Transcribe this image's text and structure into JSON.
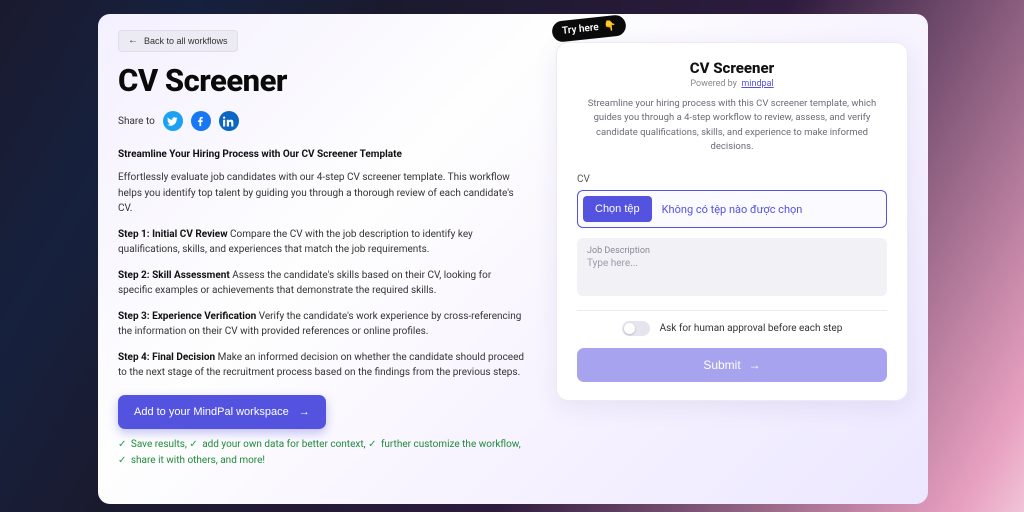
{
  "back_button": "Back to all workflows",
  "title": "CV Screener",
  "share_label": "Share to",
  "subtitle": "Streamline Your Hiring Process with Our CV Screener Template",
  "intro": "Effortlessly evaluate job candidates with our 4-step CV screener template. This workflow helps you identify top talent by guiding you through a thorough review of each candidate's CV.",
  "steps": [
    {
      "lead": "Step 1: Initial CV Review",
      "body": " Compare the CV with the job description to identify key qualifications, skills, and experiences that match the job requirements."
    },
    {
      "lead": "Step 2: Skill Assessment",
      "body": " Assess the candidate's skills based on their CV, looking for specific examples or achievements that demonstrate the required skills."
    },
    {
      "lead": "Step 3: Experience Verification",
      "body": " Verify the candidate's work experience by cross-referencing the information on their CV with provided references or online profiles."
    },
    {
      "lead": "Step 4: Final Decision",
      "body": " Make an informed decision on whether the candidate should proceed to the next stage of the recruitment process based on the findings from the previous steps."
    }
  ],
  "cta": "Add to your MindPal workspace",
  "features": [
    "Save results,",
    "add your own data for better context,",
    "further customize the workflow,",
    "share it with others, and more!"
  ],
  "widget": {
    "try_tag": "Try here",
    "title": "CV Screener",
    "powered_prefix": "Powered by",
    "powered_brand": "mindpal",
    "description": "Streamline your hiring process with this CV screener template, which guides you through a 4-step workflow to review, assess, and verify candidate qualifications, skills, and experience to make informed decisions.",
    "cv_label": "CV",
    "file_button": "Chọn tệp",
    "file_status": "Không có tệp nào được chọn",
    "jobdesc_label": "Job Description",
    "jobdesc_placeholder": "Type here...",
    "approval_label": "Ask for human approval before each step",
    "submit": "Submit"
  }
}
